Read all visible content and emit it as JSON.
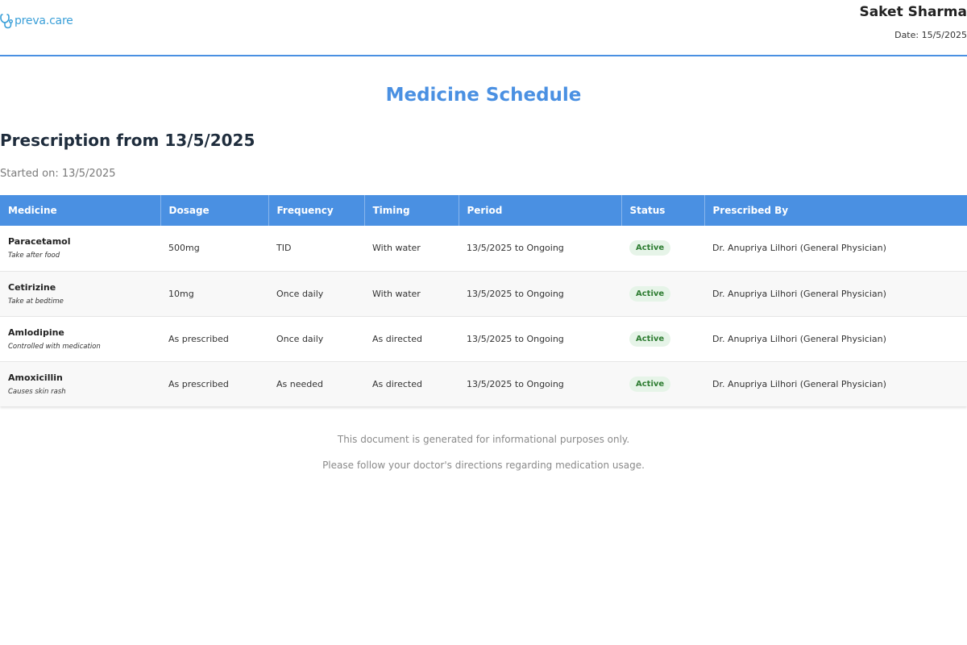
{
  "brand": {
    "name": "preva.care",
    "color": "#3a9fd8",
    "icon": "stethoscope-icon"
  },
  "patient": {
    "name": "Saket Sharma",
    "date": "Date: 15/5/2025"
  },
  "page_title": "Medicine Schedule",
  "prescription": {
    "title": "Prescription from 13/5/2025",
    "started": "Started on: 13/5/2025"
  },
  "table": {
    "headers": [
      "Medicine",
      "Dosage",
      "Frequency",
      "Timing",
      "Period",
      "Status",
      "Prescribed By"
    ],
    "rows": [
      {
        "medicine": "Paracetamol",
        "note": "Take after food",
        "dosage": "500mg",
        "frequency": "TID",
        "timing": "With water",
        "period": "13/5/2025 to Ongoing",
        "status": "Active",
        "prescribed_by": "Dr. Anupriya Lilhori (General Physician)"
      },
      {
        "medicine": "Cetirizine",
        "note": "Take at bedtime",
        "dosage": "10mg",
        "frequency": "Once daily",
        "timing": "With water",
        "period": "13/5/2025 to Ongoing",
        "status": "Active",
        "prescribed_by": "Dr. Anupriya Lilhori (General Physician)"
      },
      {
        "medicine": "Amlodipine",
        "note": "Controlled with medication",
        "dosage": "As prescribed",
        "frequency": "Once daily",
        "timing": "As directed",
        "period": "13/5/2025 to Ongoing",
        "status": "Active",
        "prescribed_by": "Dr. Anupriya Lilhori (General Physician)"
      },
      {
        "medicine": "Amoxicillin",
        "note": "Causes skin rash",
        "dosage": "As prescribed",
        "frequency": "As needed",
        "timing": "As directed",
        "period": "13/5/2025 to Ongoing",
        "status": "Active",
        "prescribed_by": "Dr. Anupriya Lilhori (General Physician)"
      }
    ]
  },
  "footer": {
    "line1": "This document is generated for informational purposes only.",
    "line2": "Please follow your doctor's directions regarding medication usage."
  },
  "colors": {
    "accent": "#4a90e2",
    "active_badge_bg": "#e6f4e8",
    "active_badge_text": "#2e7d32"
  }
}
